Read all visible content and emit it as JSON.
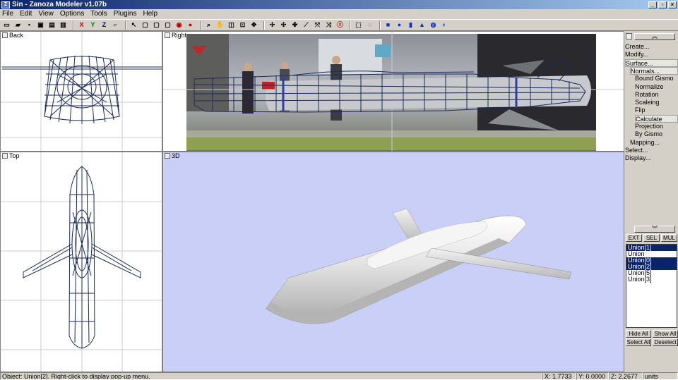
{
  "window": {
    "title": "Sin - Zanoza Modeler v1.07b"
  },
  "menu": [
    "File",
    "Edit",
    "View",
    "Options",
    "Tools",
    "Plugins",
    "Help"
  ],
  "toolbar": {
    "groups": [
      [
        {
          "icon": "new-icon",
          "glyph": "▭"
        },
        {
          "icon": "open-icon",
          "glyph": "▰"
        },
        {
          "icon": "save-icon",
          "glyph": "▪"
        },
        {
          "icon": "save-as-icon",
          "glyph": "▣"
        },
        {
          "icon": "export-icon",
          "glyph": "▤"
        },
        {
          "icon": "import-icon",
          "glyph": "▥"
        }
      ],
      [
        {
          "icon": "x-axis-icon",
          "glyph": "X",
          "color": "#d00000"
        },
        {
          "icon": "y-axis-icon",
          "glyph": "Y",
          "color": "#008000"
        },
        {
          "icon": "z-axis-icon",
          "glyph": "Z",
          "color": "#0000c0"
        },
        {
          "icon": "axis-lock-icon",
          "glyph": "⌐"
        }
      ],
      [
        {
          "icon": "select-arrow-icon",
          "glyph": "↖"
        },
        {
          "icon": "box-icon-1",
          "glyph": "▢"
        },
        {
          "icon": "box-icon-2",
          "glyph": "▢"
        },
        {
          "icon": "box-icon-3",
          "glyph": "▢"
        },
        {
          "icon": "wire-sphere-icon",
          "glyph": "◉",
          "color": "#a00000"
        },
        {
          "icon": "sphere-icon",
          "glyph": "●",
          "color": "#d00000"
        }
      ],
      [
        {
          "icon": "zoom-icon",
          "glyph": "⌕"
        },
        {
          "icon": "pan-hand-icon",
          "glyph": "✋"
        },
        {
          "icon": "orbit-icon",
          "glyph": "◫"
        },
        {
          "icon": "zoom-region-icon",
          "glyph": "⊡"
        },
        {
          "icon": "fit-view-icon",
          "glyph": "✥"
        }
      ],
      [
        {
          "icon": "move-icon",
          "glyph": "✢"
        },
        {
          "icon": "scale-icon",
          "glyph": "✣"
        },
        {
          "icon": "rotate-icon",
          "glyph": "✤"
        },
        {
          "icon": "shear-icon",
          "glyph": "⟋"
        },
        {
          "icon": "mirror-icon",
          "glyph": "⤧"
        },
        {
          "icon": "bend-icon",
          "glyph": "⤨"
        },
        {
          "icon": "twist-icon",
          "glyph": "ⓩ",
          "color": "#c00000"
        }
      ],
      [
        {
          "icon": "select-region-icon",
          "glyph": "⬚"
        },
        {
          "icon": "select-lasso-icon",
          "glyph": "◌",
          "color": "#c00000"
        }
      ],
      [
        {
          "icon": "cube-primitive-icon",
          "glyph": "■",
          "color": "#1030c0"
        },
        {
          "icon": "sphere-primitive-icon",
          "glyph": "●",
          "color": "#1030c0"
        },
        {
          "icon": "cylinder-primitive-icon",
          "glyph": "▮",
          "color": "#1030c0"
        },
        {
          "icon": "cone-primitive-icon",
          "glyph": "▲",
          "color": "#1030c0"
        },
        {
          "icon": "torus-primitive-icon",
          "glyph": "◍",
          "color": "#1030c0"
        },
        {
          "icon": "tube-primitive-icon",
          "glyph": "◐",
          "color": "#1030c0"
        }
      ]
    ]
  },
  "viewports": {
    "back": "Back",
    "right": "Right",
    "top": "Top",
    "persp": "3D"
  },
  "panel": {
    "menu": [
      {
        "label": "Create...",
        "indent": 0,
        "hl": false
      },
      {
        "label": "Modify...",
        "indent": 0,
        "hl": false
      },
      {
        "label": "Surface...",
        "indent": 0,
        "hl": true
      },
      {
        "label": "Normals...",
        "indent": 1,
        "hl": true
      },
      {
        "label": "Bound Gismo",
        "indent": 2,
        "hl": false
      },
      {
        "label": "Normalize",
        "indent": 2,
        "hl": false
      },
      {
        "label": "Rotation",
        "indent": 2,
        "hl": false
      },
      {
        "label": "Scaleing",
        "indent": 2,
        "hl": false
      },
      {
        "label": "Flip",
        "indent": 2,
        "hl": false
      },
      {
        "label": "Calculate",
        "indent": 2,
        "hl": true
      },
      {
        "label": "Projection",
        "indent": 2,
        "hl": false
      },
      {
        "label": "By Gismo",
        "indent": 2,
        "hl": false
      },
      {
        "label": "Mapping...",
        "indent": 1,
        "hl": false
      },
      {
        "label": "Select...",
        "indent": 0,
        "hl": false
      },
      {
        "label": "Display...",
        "indent": 0,
        "hl": false
      }
    ],
    "mode_buttons": [
      "EXT",
      "SEL",
      "MUL"
    ],
    "objects": [
      {
        "name": "Union[1]",
        "selected": true
      },
      {
        "name": "Union",
        "selected": false
      },
      {
        "name": "Union[0]",
        "selected": true
      },
      {
        "name": "Union[2]",
        "selected": true
      },
      {
        "name": "Union[5]",
        "selected": false
      },
      {
        "name": "Union[3]",
        "selected": false
      }
    ],
    "buttons": [
      "Hide All",
      "Show All",
      "Select All",
      "Deselect"
    ]
  },
  "status": {
    "message": "Object: Union[2]. Right-click to display pop-up menu.",
    "x": "X: 1.7733",
    "y": "Y: 0.0000",
    "z": "Z: 2.2677",
    "units": "units"
  },
  "colors": {
    "titlebar": "#0a246a",
    "wire": "#1a2a5a",
    "persp_bg": "#c9cff7",
    "selection": "#0a246a"
  }
}
